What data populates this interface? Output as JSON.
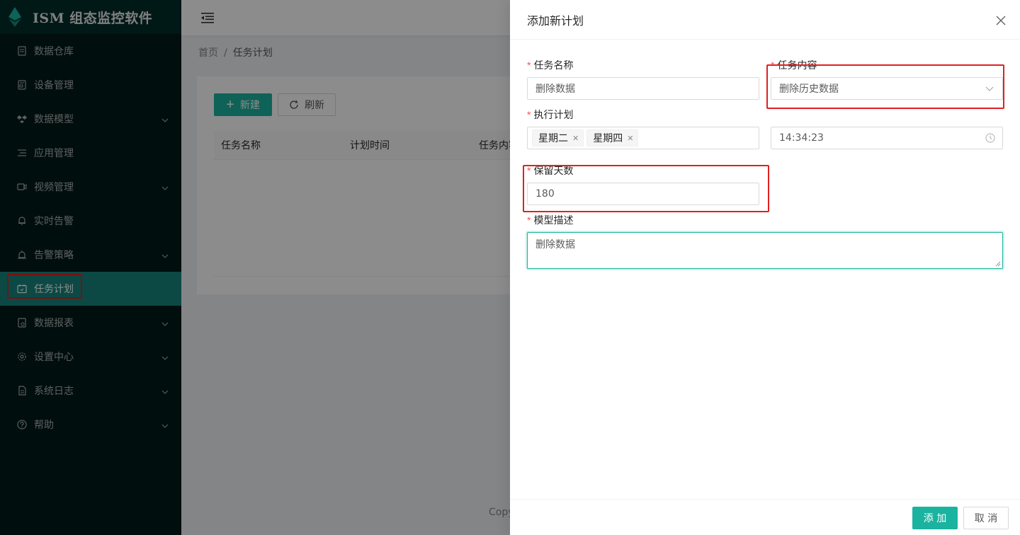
{
  "app": {
    "title": "ISM 组态监控软件"
  },
  "sidebar": {
    "items": [
      {
        "label": "数据仓库",
        "icon": "database-icon",
        "has_children": false,
        "active": false
      },
      {
        "label": "设备管理",
        "icon": "device-icon",
        "has_children": false,
        "active": false
      },
      {
        "label": "数据模型",
        "icon": "dropbox-icon",
        "has_children": true,
        "active": false
      },
      {
        "label": "应用管理",
        "icon": "list-icon",
        "has_children": false,
        "active": false
      },
      {
        "label": "视频管理",
        "icon": "video-icon",
        "has_children": true,
        "active": false
      },
      {
        "label": "实时告警",
        "icon": "bell-icon",
        "has_children": false,
        "active": false
      },
      {
        "label": "告警策略",
        "icon": "alarm-icon",
        "has_children": true,
        "active": false
      },
      {
        "label": "任务计划",
        "icon": "calendar-icon",
        "has_children": false,
        "active": true
      },
      {
        "label": "数据报表",
        "icon": "report-icon",
        "has_children": true,
        "active": false
      },
      {
        "label": "设置中心",
        "icon": "gear-icon",
        "has_children": true,
        "active": false
      },
      {
        "label": "系统日志",
        "icon": "log-icon",
        "has_children": true,
        "active": false
      },
      {
        "label": "帮助",
        "icon": "question-icon",
        "has_children": true,
        "active": false
      }
    ]
  },
  "breadcrumb": {
    "home": "首页",
    "separator": "/",
    "current": "任务计划"
  },
  "toolbar": {
    "new_label": "新建",
    "refresh_label": "刷新"
  },
  "table": {
    "columns": [
      "任务名称",
      "计划时间",
      "任务内容"
    ]
  },
  "footer": {
    "copyright": "Copy"
  },
  "drawer": {
    "title": "添加新计划",
    "fields": {
      "task_name": {
        "label": "任务名称",
        "value": "删除数据"
      },
      "task_content": {
        "label": "任务内容",
        "value": "删除历史数据"
      },
      "schedule": {
        "label": "执行计划",
        "tags": [
          "星期二",
          "星期四"
        ],
        "time": "14:34:23"
      },
      "retain_days": {
        "label": "保留天数",
        "value": "180"
      },
      "description": {
        "label": "模型描述",
        "value": "删除数据"
      }
    },
    "add_label": "添 加",
    "cancel_label": "取 消"
  },
  "colors": {
    "accent": "#1ab39f",
    "sidebar_bg": "#001a18",
    "sidebar_active": "#17857d",
    "highlight": "#e02020",
    "required": "#ff4d4f"
  }
}
